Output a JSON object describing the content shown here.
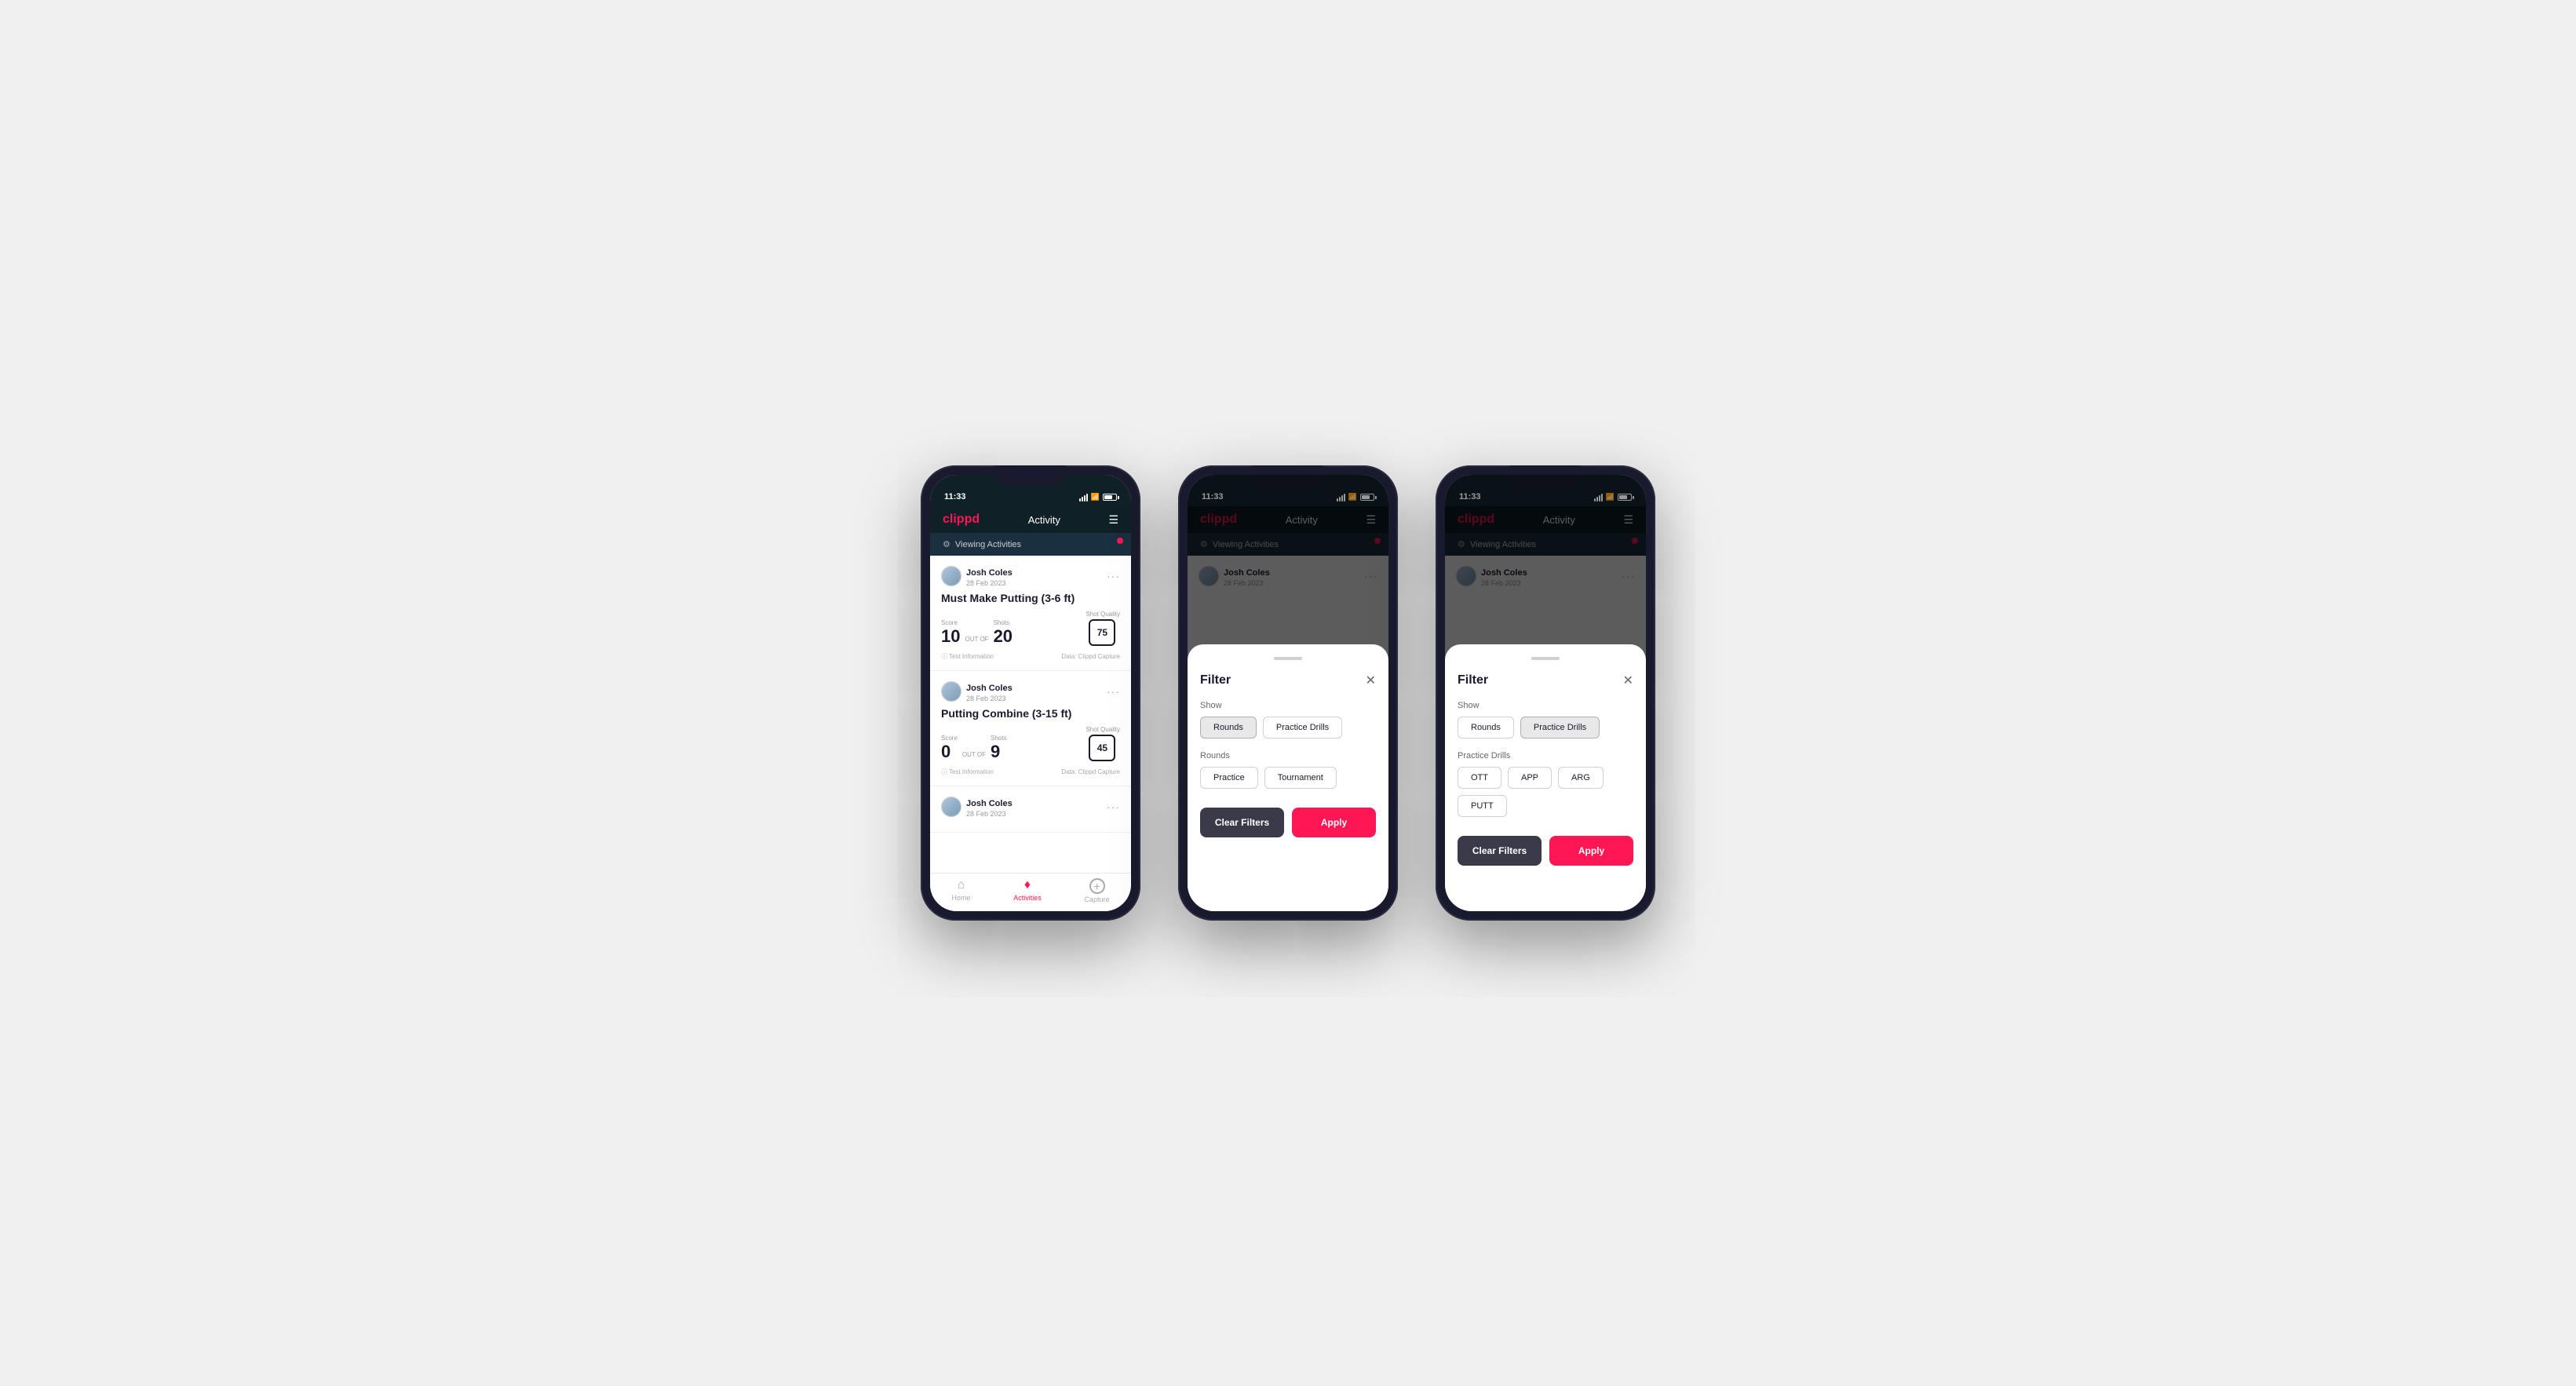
{
  "app": {
    "logo": "clippd",
    "header_title": "Activity",
    "time": "11:33"
  },
  "viewing_activities": {
    "label": "Viewing Activities"
  },
  "user": {
    "name": "Josh Coles",
    "date": "28 Feb 2023"
  },
  "activities": [
    {
      "title": "Must Make Putting (3-6 ft)",
      "score_label": "Score",
      "score": "10",
      "out_of_label": "OUT OF",
      "out_of": "20",
      "shots_label": "Shots",
      "shots": "20",
      "shot_quality_label": "Shot Quality",
      "shot_quality": "75",
      "info": "Test Information",
      "data": "Data: Clippd Capture"
    },
    {
      "title": "Putting Combine (3-15 ft)",
      "score_label": "Score",
      "score": "0",
      "out_of_label": "OUT OF",
      "out_of": "9",
      "shots_label": "Shots",
      "shots": "9",
      "shot_quality_label": "Shot Quality",
      "shot_quality": "45",
      "info": "Test Information",
      "data": "Data: Clippd Capture"
    }
  ],
  "bottom_nav": [
    {
      "label": "Home",
      "icon": "⌂",
      "active": false
    },
    {
      "label": "Activities",
      "icon": "♣",
      "active": true
    },
    {
      "label": "Capture",
      "icon": "+",
      "active": false
    }
  ],
  "filter_modal_1": {
    "title": "Filter",
    "show_label": "Show",
    "show_buttons": [
      {
        "label": "Rounds",
        "active": true
      },
      {
        "label": "Practice Drills",
        "active": false
      }
    ],
    "rounds_label": "Rounds",
    "rounds_buttons": [
      {
        "label": "Practice",
        "active": false
      },
      {
        "label": "Tournament",
        "active": false
      }
    ],
    "clear_label": "Clear Filters",
    "apply_label": "Apply"
  },
  "filter_modal_2": {
    "title": "Filter",
    "show_label": "Show",
    "show_buttons": [
      {
        "label": "Rounds",
        "active": false
      },
      {
        "label": "Practice Drills",
        "active": true
      }
    ],
    "drills_label": "Practice Drills",
    "drills_buttons": [
      {
        "label": "OTT",
        "active": false
      },
      {
        "label": "APP",
        "active": false
      },
      {
        "label": "ARG",
        "active": false
      },
      {
        "label": "PUTT",
        "active": false
      }
    ],
    "clear_label": "Clear Filters",
    "apply_label": "Apply"
  }
}
